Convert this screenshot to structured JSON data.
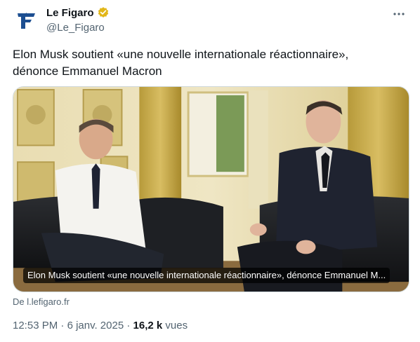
{
  "account": {
    "name": "Le Figaro",
    "handle": "@Le_Figaro",
    "verified_color": "#e2b719",
    "logo_color": "#1d4f91"
  },
  "icons": {
    "logo": "le-figaro-logo",
    "verified": "verified-badge-icon",
    "more": "more-options-icon"
  },
  "tweet": {
    "text_line1": "Elon Musk soutient «une nouvelle internationale réactionnaire»,",
    "text_line2": "dénonce Emmanuel Macron"
  },
  "card": {
    "caption": "Elon Musk soutient «une nouvelle internationale réactionnaire», dénonce Emmanuel M...",
    "source": "De l.lefigaro.fr"
  },
  "meta": {
    "time": "12:53 PM",
    "separator": "·",
    "date": "6 janv. 2025",
    "views_count": "16,2 k",
    "views_label": "vues"
  }
}
